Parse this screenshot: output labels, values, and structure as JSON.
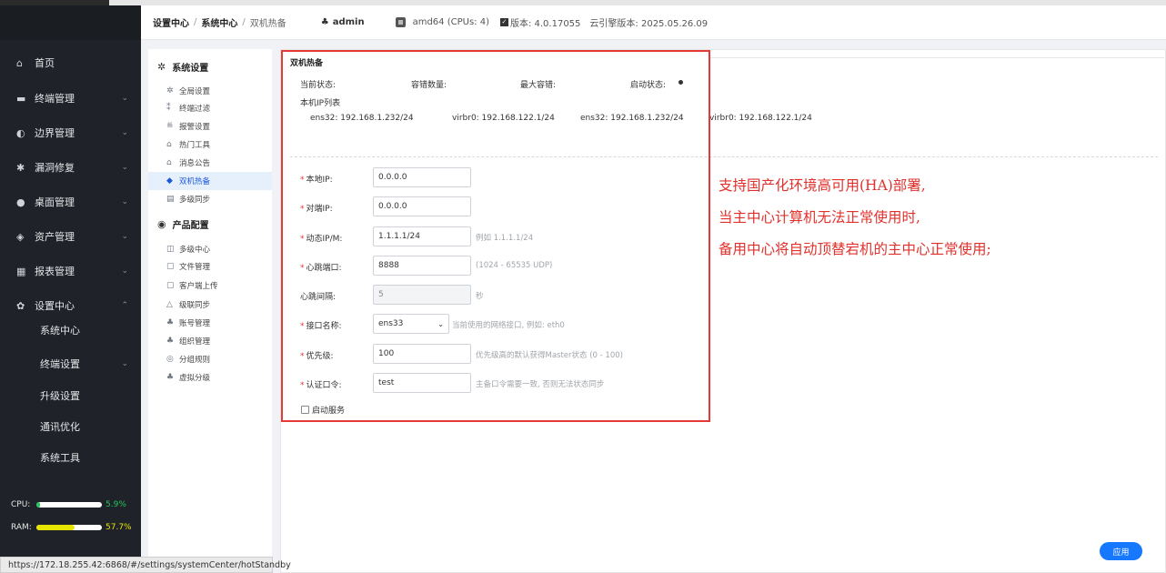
{
  "header": {
    "breadcrumb": [
      "设置中心",
      "系统中心",
      "双机热备"
    ],
    "user": "admin",
    "cpu_info": "amd64 (CPUs: 4)",
    "version": "版本: 4.0.17055",
    "engine_version": "云引擎版本: 2025.05.26.09"
  },
  "sidebar": {
    "items": [
      {
        "label": "首页",
        "icon": "home-icon"
      },
      {
        "label": "终端管理",
        "icon": "terminal-icon"
      },
      {
        "label": "边界管理",
        "icon": "boundary-icon"
      },
      {
        "label": "漏洞修复",
        "icon": "bug-fix-icon"
      },
      {
        "label": "桌面管理",
        "icon": "desktop-icon"
      },
      {
        "label": "资产管理",
        "icon": "asset-icon"
      },
      {
        "label": "报表管理",
        "icon": "report-icon"
      },
      {
        "label": "设置中心",
        "icon": "gear-icon"
      }
    ],
    "subitems": [
      "系统中心",
      "终端设置",
      "升级设置",
      "通讯优化",
      "系统工具"
    ],
    "cpu": {
      "label": "CPU:",
      "value": "5.9%",
      "fraction": 0.059,
      "color": "#22c55e"
    },
    "ram": {
      "label": "RAM:",
      "value": "57.7%",
      "fraction": 0.577,
      "color": "#e5e500"
    }
  },
  "menu2": {
    "group1": "系统设置",
    "group1_items": [
      "全局设置",
      "终端过滤",
      "报警设置",
      "热门工具",
      "消息公告",
      "双机热备",
      "多级同步"
    ],
    "group2": "产品配置",
    "group2_items": [
      "多级中心",
      "文件管理",
      "客户端上传",
      "级联同步",
      "账号管理",
      "组织管理",
      "分组规则",
      "虚拟分级"
    ]
  },
  "panel": {
    "title": "双机热备",
    "status_labels": [
      "当前状态:",
      "容错数量:",
      "最大容错:",
      "启动状态:"
    ],
    "ip_list_title": "本机IP列表",
    "ip_list": [
      "ens32: 192.168.1.232/24",
      "virbr0: 192.168.122.1/24",
      "ens32: 192.168.1.232/24",
      "virbr0: 192.168.122.1/24"
    ],
    "form": {
      "local_ip": {
        "label": "本地IP:",
        "value": "0.0.0.0"
      },
      "peer_ip": {
        "label": "对端IP:",
        "value": "0.0.0.0"
      },
      "dynamic_ip": {
        "label": "动态IP/M:",
        "value": "1.1.1.1/24",
        "hint": "例如 1.1.1.1/24"
      },
      "heartbeat_port": {
        "label": "心跳端口:",
        "value": "8888",
        "hint": "(1024 - 65535 UDP)"
      },
      "heartbeat_interval": {
        "label": "心跳间隔:",
        "value": "5",
        "hint": "秒"
      },
      "interface": {
        "label": "接口名称:",
        "value": "ens33",
        "hint": "当前使用的网络接口, 例如: eth0"
      },
      "priority": {
        "label": "优先级:",
        "value": "100",
        "hint": "优先级高的默认获得Master状态 (0 - 100)"
      },
      "auth": {
        "label": "认证口令:",
        "value": "test",
        "hint": "主备口令需要一致, 否则无法状态同步"
      },
      "start_service": "启动服务"
    },
    "apply": "应用"
  },
  "annotation": [
    "支持国产化环境高可用(HA)部署,",
    "当主中心计算机无法正常使用时,",
    "备用中心将自动顶替宕机的主中心正常使用;"
  ],
  "status_url": "https://172.18.255.42:6868/#/settings/systemCenter/hotStandby"
}
